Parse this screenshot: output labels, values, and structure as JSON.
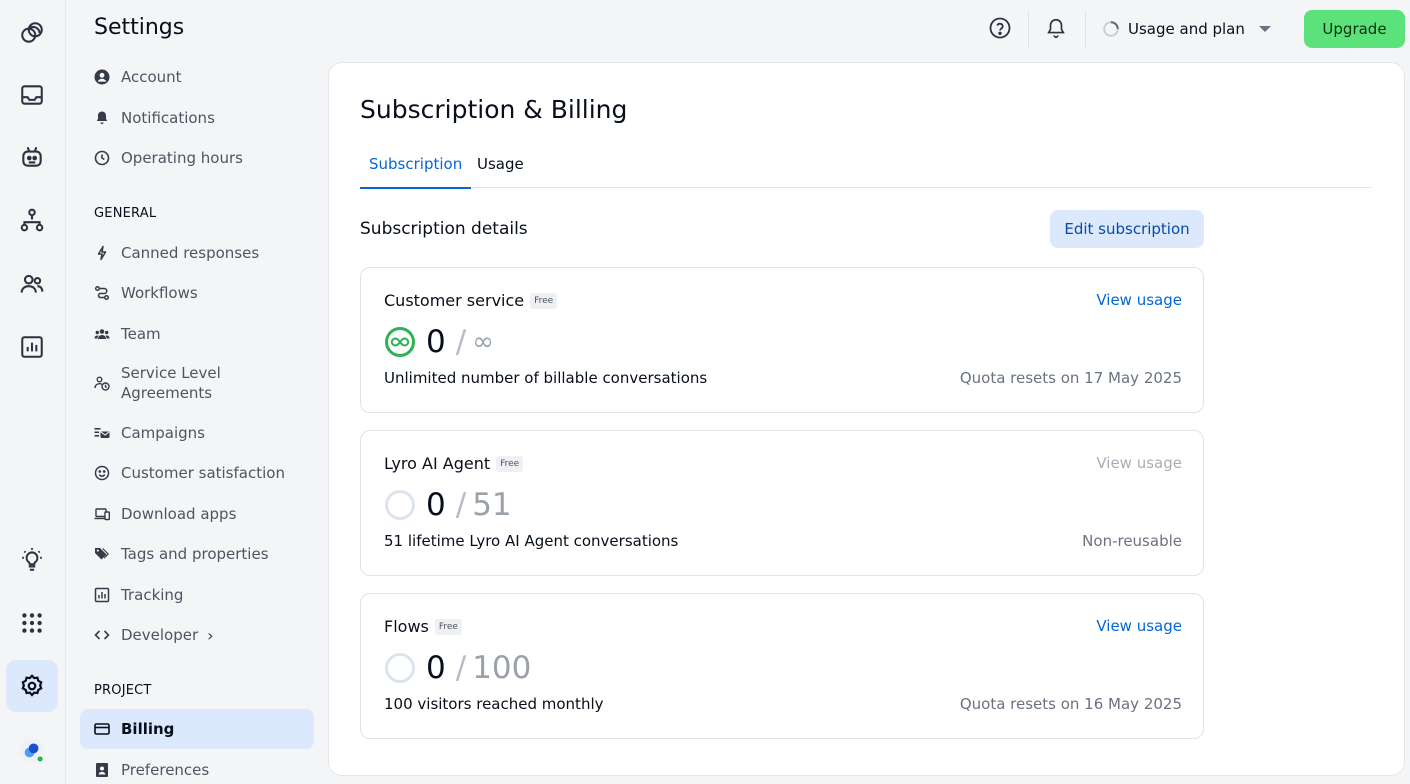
{
  "app": {
    "rail": [
      {
        "name": "dashboard-icon"
      },
      {
        "name": "inbox-icon"
      },
      {
        "name": "bot-icon"
      },
      {
        "name": "flows-icon"
      },
      {
        "name": "customers-icon"
      },
      {
        "name": "analytics-icon"
      },
      {
        "name": "ideas-icon"
      },
      {
        "name": "apps-grid-icon"
      },
      {
        "name": "settings-icon",
        "active": true
      },
      {
        "name": "avatar"
      }
    ]
  },
  "sidebar": {
    "title": "Settings",
    "items_top": [
      {
        "label": "Account",
        "icon": "account-icon"
      },
      {
        "label": "Notifications",
        "icon": "bell-icon"
      },
      {
        "label": "Operating hours",
        "icon": "clock-icon"
      }
    ],
    "general_label": "GENERAL",
    "items_general": [
      {
        "label": "Canned responses",
        "icon": "lightning-icon"
      },
      {
        "label": "Workflows",
        "icon": "workflow-icon"
      },
      {
        "label": "Team",
        "icon": "team-icon"
      },
      {
        "label": "Service Level Agreements",
        "icon": "sla-icon"
      },
      {
        "label": "Campaigns",
        "icon": "campaign-icon"
      },
      {
        "label": "Customer satisfaction",
        "icon": "smiley-icon"
      },
      {
        "label": "Download apps",
        "icon": "devices-icon"
      },
      {
        "label": "Tags and properties",
        "icon": "tag-icon"
      },
      {
        "label": "Tracking",
        "icon": "chart-icon"
      },
      {
        "label": "Developer",
        "icon": "code-icon",
        "chevron": "›"
      }
    ],
    "project_label": "PROJECT",
    "items_project": [
      {
        "label": "Billing",
        "icon": "card-icon",
        "active": true
      },
      {
        "label": "Preferences",
        "icon": "preferences-icon"
      }
    ]
  },
  "topbar": {
    "usage_label": "Usage and plan",
    "upgrade_label": "Upgrade"
  },
  "main": {
    "title": "Subscription & Billing",
    "tabs": [
      {
        "label": "Subscription",
        "active": true
      },
      {
        "label": "Usage"
      }
    ],
    "section_title": "Subscription details",
    "edit_label": "Edit subscription",
    "cards": [
      {
        "name": "Customer service",
        "badge": "Free",
        "view_label": "View usage",
        "view_enabled": true,
        "count": "0",
        "limit": "∞",
        "ring_color": "#2db352",
        "description": "Unlimited number of billable conversations",
        "note": "Quota resets on 17 May 2025"
      },
      {
        "name": "Lyro AI Agent",
        "badge": "Free",
        "view_label": "View usage",
        "view_enabled": false,
        "count": "0",
        "limit": "51",
        "ring_color": "#dde4ee",
        "description": "51 lifetime Lyro AI Agent conversations",
        "note": "Non-reusable"
      },
      {
        "name": "Flows",
        "badge": "Free",
        "view_label": "View usage",
        "view_enabled": true,
        "count": "0",
        "limit": "100",
        "ring_color": "#dde4ee",
        "description": "100 visitors reached monthly",
        "note": "Quota resets on 16 May 2025"
      }
    ]
  }
}
